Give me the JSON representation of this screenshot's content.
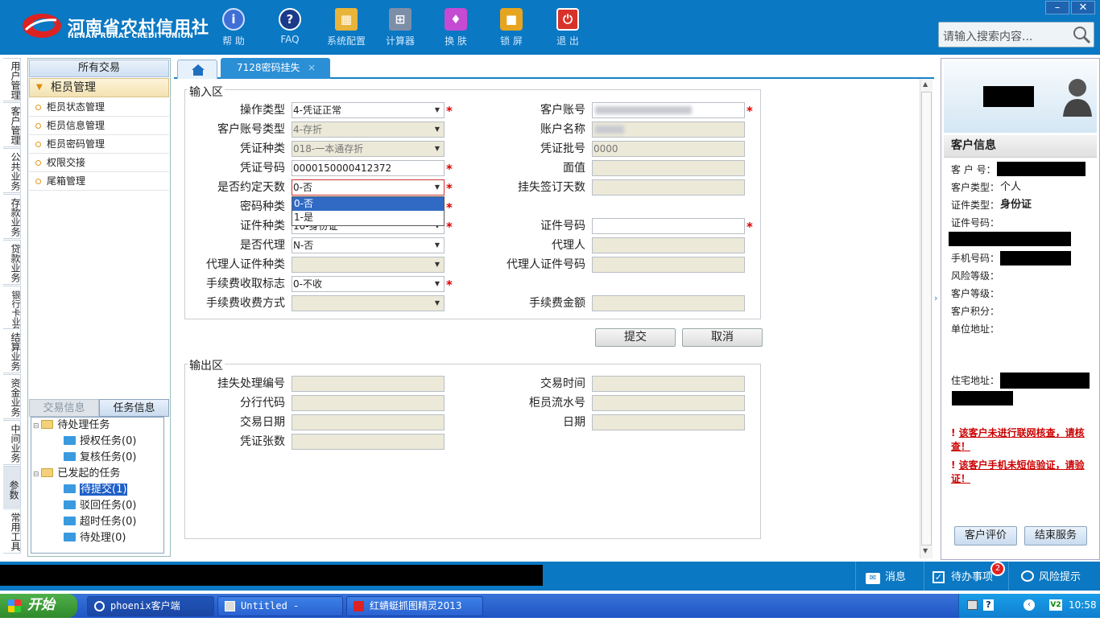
{
  "header": {
    "logo_cn": "河南省农村信用社",
    "logo_en": "HENAN RURAL CREDIT UNION",
    "toolbar": [
      {
        "label": "帮 助",
        "icon": "info-icon"
      },
      {
        "label": "FAQ",
        "icon": "help-icon"
      },
      {
        "label": "系统配置",
        "icon": "toolbox-icon"
      },
      {
        "label": "计算器",
        "icon": "calculator-icon"
      },
      {
        "label": "换 肤",
        "icon": "shirt-icon"
      },
      {
        "label": "锁 屏",
        "icon": "lock-icon"
      },
      {
        "label": "退 出",
        "icon": "power-icon"
      }
    ],
    "search_placeholder": "请输入搜索内容...",
    "window_min": "–",
    "window_close": "✕"
  },
  "vtabs": [
    "用户管理",
    "客户管理",
    "公共业务",
    "存款业务",
    "贷款业务",
    "银行卡业务",
    "结算业务",
    "资金业务",
    "中间业务",
    "参数",
    "常用工具"
  ],
  "left_panel": {
    "header": "所有交易",
    "group": "柜员管理",
    "items": [
      "柜员状态管理",
      "柜员信息管理",
      "柜员密码管理",
      "权限交接",
      "尾箱管理"
    ],
    "tabs": [
      "交易信息",
      "任务信息"
    ],
    "tree": {
      "pending": "待处理任务",
      "pending_children": [
        "授权任务(0)",
        "复核任务(0)"
      ],
      "initiated": "已发起的任务",
      "initiated_children": [
        "待提交(1)",
        "驳回任务(0)",
        "超时任务(0)",
        "待处理(0)"
      ]
    }
  },
  "tab": {
    "title": "7128密码挂失",
    "close": "×"
  },
  "input_area": {
    "legend": "输入区",
    "left_fields": [
      {
        "label": "操作类型",
        "value": "4-凭证正常",
        "select": true,
        "required": true,
        "disabled": false
      },
      {
        "label": "客户账号类型",
        "value": "4-存折",
        "select": true,
        "required": false,
        "disabled": true
      },
      {
        "label": "凭证种类",
        "value": "018-一本通存折",
        "select": true,
        "required": false,
        "disabled": true
      },
      {
        "label": "凭证号码",
        "value": "0000150000412372",
        "select": false,
        "required": true,
        "disabled": false
      },
      {
        "label": "是否约定天数",
        "value": "0-否",
        "select": true,
        "required": true,
        "disabled": false
      },
      {
        "label": "密码种类",
        "value": "",
        "select": true,
        "required": true,
        "disabled": false
      },
      {
        "label": "证件种类",
        "value": "10-身份证",
        "select": true,
        "required": true,
        "disabled": false
      },
      {
        "label": "是否代理",
        "value": "N-否",
        "select": true,
        "required": false,
        "disabled": false
      },
      {
        "label": "代理人证件种类",
        "value": "",
        "select": true,
        "required": false,
        "disabled": true
      },
      {
        "label": "手续费收取标志",
        "value": "0-不收",
        "select": true,
        "required": true,
        "disabled": false
      },
      {
        "label": "手续费收费方式",
        "value": "",
        "select": true,
        "required": false,
        "disabled": true
      }
    ],
    "right_fields": [
      {
        "label": "客户账号",
        "value": "",
        "required": true,
        "disabled": false
      },
      {
        "label": "账户名称",
        "value": "",
        "required": false,
        "disabled": true
      },
      {
        "label": "凭证批号",
        "value": "0000",
        "required": false,
        "disabled": true
      },
      {
        "label": "面值",
        "value": "",
        "required": false,
        "disabled": true
      },
      {
        "label": "挂失签订天数",
        "value": "",
        "required": false,
        "disabled": true
      },
      {
        "label": "证件号码",
        "value": "",
        "required": true,
        "disabled": false
      },
      {
        "label": "代理人",
        "value": "",
        "required": false,
        "disabled": true
      },
      {
        "label": "代理人证件号码",
        "value": "",
        "required": false,
        "disabled": true
      },
      {
        "label": "手续费金额",
        "value": "",
        "required": false,
        "disabled": true
      }
    ],
    "dropdown_options": [
      "0-否",
      "1-是"
    ],
    "submit": "提交",
    "cancel": "取消"
  },
  "output_area": {
    "legend": "输出区",
    "left_fields": [
      "挂失处理编号",
      "分行代码",
      "交易日期",
      "凭证张数"
    ],
    "right_fields": [
      "交易时间",
      "柜员流水号",
      "日期"
    ]
  },
  "customer": {
    "title": "客户信息",
    "no_label": "客 户 号：",
    "type_label": "客户类型：",
    "type_value": "个人",
    "id_type_label": "证件类型：",
    "id_type_value": "身份证",
    "id_no_label": "证件号码：",
    "phone_label": "手机号码：",
    "risk_label": "风险等级：",
    "level_label": "客户等级：",
    "points_label": "客户积分：",
    "company_label": "单位地址：",
    "home_label": "住宅地址：",
    "warning1": "该客户未进行联网核查，请核查！",
    "warning2": "该客户手机未短信验证，请验证！",
    "rate_btn": "客户评价",
    "end_btn": "结束服务"
  },
  "statusbar": {
    "messages": "消息",
    "todo": "待办事项",
    "todo_count": "2",
    "risk": "风险提示"
  },
  "taskbar": {
    "start": "开始",
    "tasks": [
      "phoenix客户端",
      "Untitled - IDCheck",
      "红蜻蜓抓图精灵2013"
    ],
    "clock": "10:58"
  },
  "colors": {
    "header": "#0a78c3",
    "accent": "#1682c8",
    "required": "#dd0000",
    "warning": "#cc0000"
  }
}
